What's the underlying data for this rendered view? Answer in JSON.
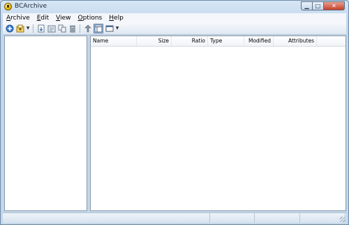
{
  "window": {
    "title": "BCArchive",
    "controls": {
      "minimize": "▁",
      "maximize": "□",
      "close": "✕"
    }
  },
  "menubar": {
    "items": [
      {
        "label": "Archive",
        "mnemonic": "A",
        "rest": "rchive"
      },
      {
        "label": "Edit",
        "mnemonic": "E",
        "rest": "dit"
      },
      {
        "label": "View",
        "mnemonic": "V",
        "rest": "iew"
      },
      {
        "label": "Options",
        "mnemonic": "O",
        "rest": "ptions"
      },
      {
        "label": "Help",
        "mnemonic": "H",
        "rest": "elp"
      }
    ]
  },
  "toolbar": {
    "buttons": [
      {
        "icon": "new-archive-icon"
      },
      {
        "icon": "open-archive-icon",
        "has_dropdown": true
      },
      {
        "icon": "add-files-icon"
      },
      {
        "icon": "extract-icon"
      },
      {
        "icon": "copy-icon"
      },
      {
        "icon": "delete-icon"
      },
      {
        "icon": "up-folder-icon"
      },
      {
        "icon": "details-view-icon",
        "active": true
      },
      {
        "icon": "view-mode-icon",
        "has_dropdown": true
      }
    ]
  },
  "file_list": {
    "columns": [
      "Name",
      "Size",
      "Ratio",
      "Type",
      "Modified",
      "Attributes"
    ],
    "rows": []
  },
  "statusbar": {
    "cells": [
      "",
      "",
      "",
      "",
      ""
    ]
  },
  "colors": {
    "window_bg": "#c3d7ec",
    "pane_bg": "#ffffff",
    "close_button": "#c6402a"
  }
}
